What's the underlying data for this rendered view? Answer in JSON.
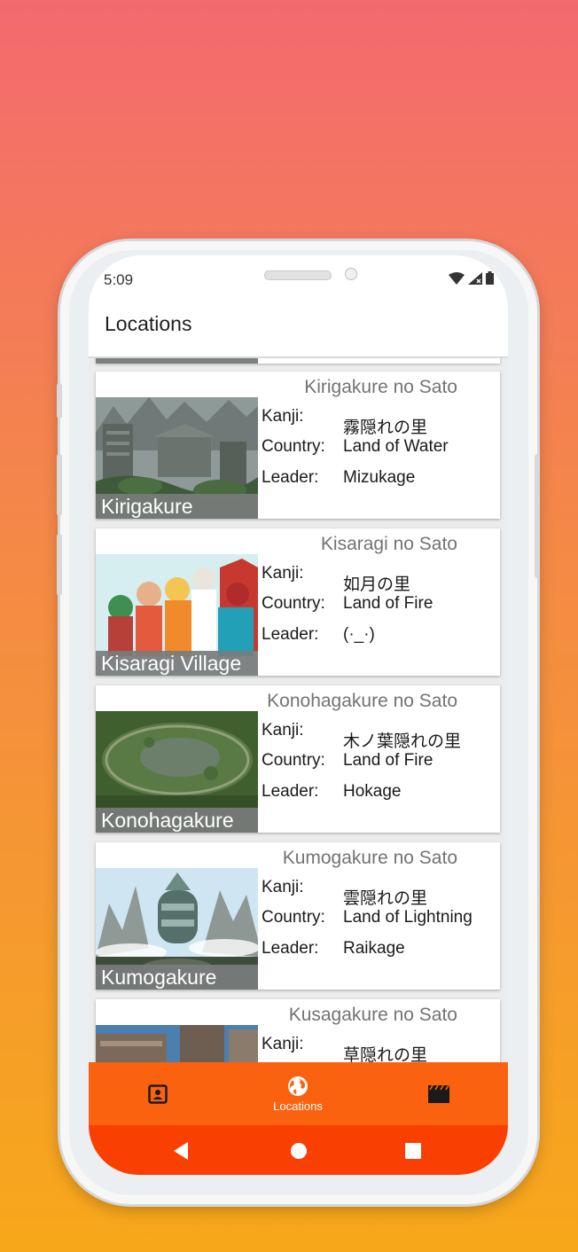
{
  "status_bar": {
    "time": "5:09"
  },
  "app_bar": {
    "title": "Locations"
  },
  "locations": [
    {
      "title": "Kirigakure no Sato",
      "name": "Kirigakure",
      "kanji_label": "Kanji:",
      "kanji": "霧隠れの里",
      "country_label": "Country:",
      "country": "Land of Water",
      "leader_label": "Leader:",
      "leader": "Mizukage"
    },
    {
      "title": "Kisaragi no Sato",
      "name": "Kisaragi Village",
      "kanji_label": "Kanji:",
      "kanji": "如月の里",
      "country_label": "Country:",
      "country": "Land of Fire",
      "leader_label": "Leader:",
      "leader": "(·_·)"
    },
    {
      "title": "Konohagakure no Sato",
      "name": "Konohagakure",
      "kanji_label": "Kanji:",
      "kanji": "木ノ葉隠れの里",
      "country_label": "Country:",
      "country": "Land of Fire",
      "leader_label": "Leader:",
      "leader": "Hokage"
    },
    {
      "title": "Kumogakure no Sato",
      "name": "Kumogakure",
      "kanji_label": "Kanji:",
      "kanji": "雲隠れの里",
      "country_label": "Country:",
      "country": "Land of Lightning",
      "leader_label": "Leader:",
      "leader": "Raikage"
    },
    {
      "title": "Kusagakure no Sato",
      "kanji_label": "Kanji:",
      "kanji": "草隠れの里"
    }
  ],
  "bottom_nav": {
    "items": [
      {
        "icon": "contact-card-icon",
        "label": ""
      },
      {
        "icon": "globe-icon",
        "label": "Locations",
        "selected": true
      },
      {
        "icon": "clapperboard-icon",
        "label": ""
      }
    ]
  },
  "colors": {
    "nav_bg": "#fb620f",
    "system_nav_bg": "#f93f02",
    "card_title": "#737373"
  }
}
